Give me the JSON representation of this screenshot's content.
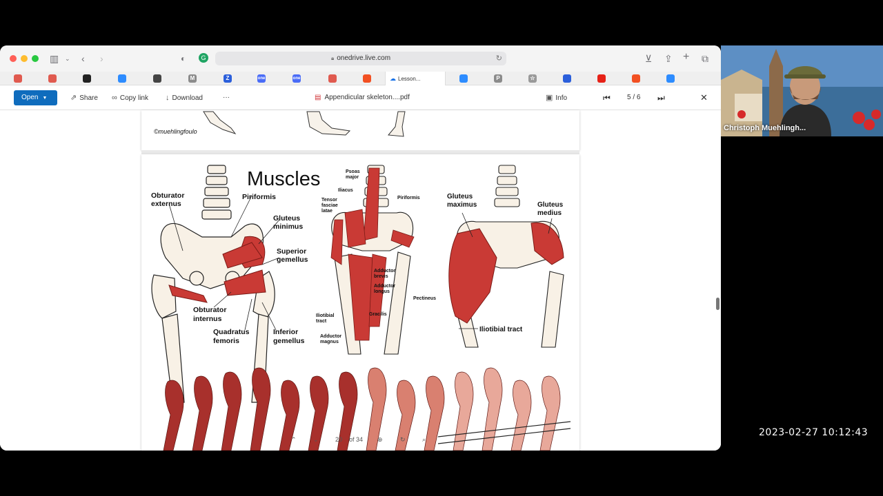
{
  "browser": {
    "url": "onedrive.live.com",
    "active_tab_label": "Lesson...",
    "favorites": [
      {
        "name": "favicon-1",
        "color": "#e05a4f"
      },
      {
        "name": "favicon-2",
        "color": "#e05a4f"
      },
      {
        "name": "favicon-3",
        "color": "#222222"
      },
      {
        "name": "favicon-4",
        "color": "#2d8cff"
      },
      {
        "name": "favicon-5",
        "color": "#444444"
      },
      {
        "name": "favicon-6",
        "color": "#8b8b8b",
        "text": "M"
      },
      {
        "name": "favicon-7",
        "color": "#2b5fdb",
        "text": "Z"
      },
      {
        "name": "favicon-8",
        "color": "#4a6cf7",
        "text": "one"
      },
      {
        "name": "favicon-9",
        "color": "#4a6cf7",
        "text": "one"
      },
      {
        "name": "favicon-10",
        "color": "#e05a4f"
      },
      {
        "name": "favicon-11",
        "color": "#f25022"
      },
      {
        "name": "favicon-12",
        "color": "#2d8cff"
      },
      {
        "name": "favicon-13",
        "color": "#8b8b8b",
        "text": "P"
      },
      {
        "name": "favicon-14",
        "color": "#999999",
        "text": "☆"
      },
      {
        "name": "favicon-15",
        "color": "#2b5fdb"
      },
      {
        "name": "favicon-16",
        "color": "#e62117"
      },
      {
        "name": "favicon-17",
        "color": "#f25022"
      },
      {
        "name": "favicon-18",
        "color": "#2d8cff"
      }
    ]
  },
  "toolbar": {
    "open_label": "Open",
    "share_label": "Share",
    "copy_link_label": "Copy link",
    "download_label": "Download",
    "more_label": "···",
    "doc_title": "Appendicular skeleton....pdf",
    "info_label": "Info",
    "page_indicator": "5 / 6"
  },
  "pdf": {
    "watermark": "©muehlingfoulo",
    "heading": "Muscles",
    "labels": {
      "obturator_externus": [
        "Obturator",
        "externus"
      ],
      "piriformis": "Piriformis",
      "gluteus_minimus": [
        "Gluteus",
        "minimus"
      ],
      "superior_gemellus": [
        "Superior",
        "gemellus"
      ],
      "obturator_internus": [
        "Obturator",
        "internus"
      ],
      "quadratus_femoris": [
        "Quadratus",
        "femoris"
      ],
      "inferior_gemellus": [
        "Inferior",
        "gemellus"
      ],
      "psoas_major": [
        "Psoas",
        "major"
      ],
      "iliacus": "Iliacus",
      "tensor_fasciae_latae": [
        "Tensor",
        "fasciae",
        "latae"
      ],
      "piriformis_2": "Piriformis",
      "adductor_brevis": [
        "Adductor",
        "brevis"
      ],
      "adductor_longus": [
        "Adductor",
        "longus"
      ],
      "pectineus": "Pectineus",
      "iliotibial_tract_small": [
        "Iliotibial",
        "tract"
      ],
      "gracilis": "Gracilis",
      "adductor_magnus": [
        "Adductor",
        "magnus"
      ],
      "gluteus_maximus": [
        "Gluteus",
        "maximus"
      ],
      "gluteus_medius": [
        "Gluteus",
        "medius"
      ],
      "iliotibial_tract": "Iliotibial tract"
    },
    "nav": {
      "current_page": "20",
      "total_pages": "of 34"
    }
  },
  "video": {
    "participant_name": "Christoph Muehlingh..."
  },
  "timestamp": "2023-02-27  10:12:43"
}
